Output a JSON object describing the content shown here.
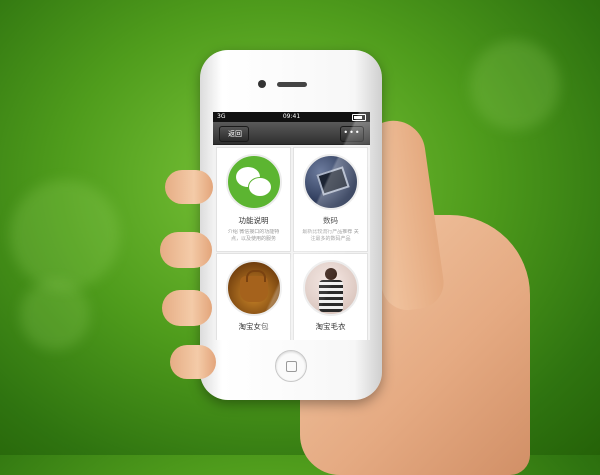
{
  "status_bar": {
    "carrier": "3G",
    "time": "09:41"
  },
  "nav": {
    "back_label": "返回",
    "more_label": "•••"
  },
  "tiles": [
    {
      "title": "功能说明",
      "desc": "介绍 微信接口的功能特点，以及使用的服务",
      "image": "wechat-logo"
    },
    {
      "title": "数码",
      "desc": "最新比较流行产品推荐 关注最多的数码产品",
      "image": "phone-in-hand-photo"
    },
    {
      "title": "淘宝女包",
      "desc": "",
      "image": "handbag-photo"
    },
    {
      "title": "淘宝毛衣",
      "desc": "",
      "image": "sweater-model-photo"
    }
  ],
  "colors": {
    "background_green": "#4f9c1c",
    "wechat_green": "#5cb531"
  }
}
